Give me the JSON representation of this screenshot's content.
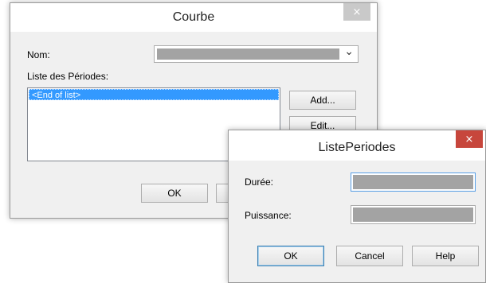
{
  "courbe_dialog": {
    "title": "Courbe",
    "close_glyph": "×",
    "nom_label": "Nom:",
    "nom_dropdown_arrow": "⌄",
    "periodes_label": "Liste des Périodes:",
    "list_items": [
      "<End of list>"
    ],
    "add_button": "Add...",
    "edit_button": "Edit...",
    "ok_button": "OK"
  },
  "listeperiodes_dialog": {
    "title": "ListePeriodes",
    "close_glyph": "×",
    "duree_label": "Durée:",
    "puissance_label": "Puissance:",
    "ok_button": "OK",
    "cancel_button": "Cancel",
    "help_button": "Help"
  },
  "colors": {
    "selection_blue": "#3399ff",
    "close_red": "#c7463c",
    "close_gray": "#c9c9c9",
    "field_gray": "#a3a3a3"
  }
}
